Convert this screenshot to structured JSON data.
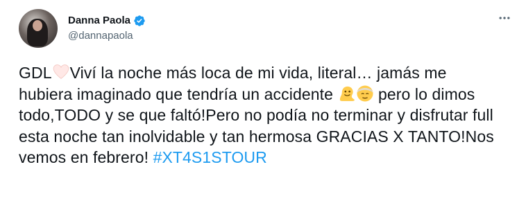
{
  "user": {
    "display_name": "Danna Paola",
    "handle": "@dannapaola",
    "verified": true
  },
  "icons": {
    "verified": "verified-badge-icon",
    "more": "more-options-icon",
    "heart": "white-heart-emoji",
    "melting": "melting-face-emoji",
    "bandage": "face-with-head-bandage-emoji"
  },
  "tweet": {
    "seg1": "GDL",
    "seg2": "Viví la noche más loca de mi vida, literal… jamás me hubiera imaginado que tendría un accidente ",
    "seg3": " pero lo dimos todo,TODO y se que faltó!Pero no podía no terminar y disfrutar full esta noche tan inolvidable y tan hermosa GRACIAS X TANTO!Nos vemos en febrero! ",
    "hashtag": "#XT4S1STOUR"
  },
  "colors": {
    "text": "#0f1419",
    "secondary": "#536471",
    "link": "#1d9bf0"
  }
}
